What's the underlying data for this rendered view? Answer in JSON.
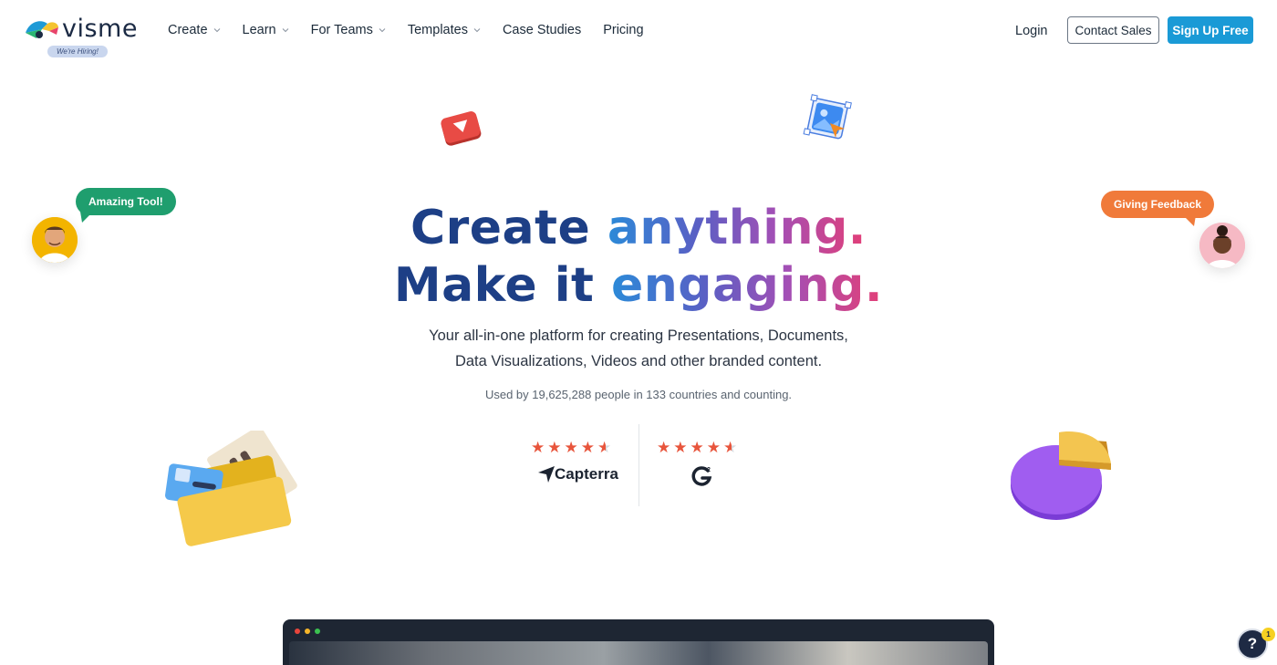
{
  "brand": {
    "name": "visme",
    "hiring_badge": "We're Hiring!"
  },
  "nav": {
    "items": [
      {
        "label": "Create",
        "dropdown": true
      },
      {
        "label": "Learn",
        "dropdown": true
      },
      {
        "label": "For Teams",
        "dropdown": true
      },
      {
        "label": "Templates",
        "dropdown": true
      },
      {
        "label": "Case Studies",
        "dropdown": false
      },
      {
        "label": "Pricing",
        "dropdown": false
      }
    ],
    "login": "Login",
    "contact_sales": "Contact Sales",
    "sign_up": "Sign Up Free"
  },
  "hero": {
    "line1_a": "Create ",
    "line1_b": "anything.",
    "line2_a": "Make it ",
    "line2_b": "engaging.",
    "subtitle_line1": "Your all-in-one platform for creating Presentations, Documents,",
    "subtitle_line2": "Data Visualizations, Videos and other branded content.",
    "usage": "Used by 19,625,288 people in 133 countries and counting."
  },
  "ratings": [
    {
      "source": "Capterra",
      "stars": 4.5
    },
    {
      "source": "G2",
      "stars": 4.5
    }
  ],
  "bubbles": {
    "left": "Amazing Tool!",
    "right": "Giving Feedback"
  },
  "help": {
    "label": "?",
    "badge": "1"
  },
  "colors": {
    "primary": "#1a9ad6",
    "heading_dark": "#1d3f86",
    "star": "#e8553c",
    "bubble_green": "#1f9e6e",
    "bubble_orange": "#f07a3a"
  }
}
